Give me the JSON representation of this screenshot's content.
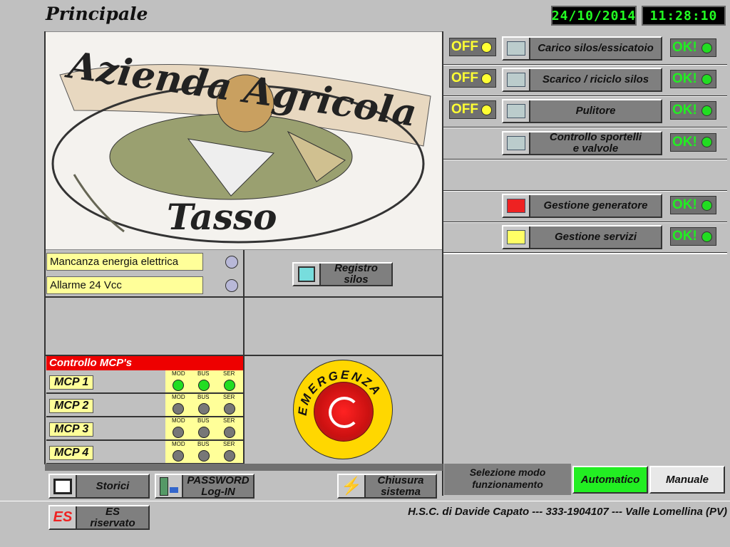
{
  "header": {
    "title": "Principale",
    "date": "24/10/2014",
    "time": "11:28:10"
  },
  "logo": {
    "line1": "Azienda Agricola",
    "line2": "Tasso"
  },
  "alarms": [
    {
      "label": "Mancanza energia elettrica"
    },
    {
      "label": "Allarme 24 Vcc"
    }
  ],
  "registro": {
    "label1": "Registro",
    "label2": "silos"
  },
  "mcp": {
    "header": "Controllo MCP's",
    "led_labels": [
      "MOD",
      "BUS",
      "SER"
    ],
    "rows": [
      {
        "label": "MCP 1",
        "leds": [
          "on",
          "on",
          "on"
        ]
      },
      {
        "label": "MCP 2",
        "leds": [
          "off",
          "off",
          "off"
        ]
      },
      {
        "label": "MCP 3",
        "leds": [
          "off",
          "off",
          "off"
        ]
      },
      {
        "label": "MCP 4",
        "leds": [
          "off",
          "off",
          "off"
        ]
      }
    ]
  },
  "emergency": {
    "label": "EMERGENZA"
  },
  "right_rows": [
    {
      "off": "OFF",
      "label": "Carico silos/essicatoio",
      "ok": "OK!",
      "icon": "silo-load-icon"
    },
    {
      "off": "OFF",
      "label": "Scarico / riciclo silos",
      "ok": "OK!",
      "icon": "silo-unload-icon"
    },
    {
      "off": "OFF",
      "label": "Pulitore",
      "ok": "OK!",
      "icon": "cleaner-icon"
    },
    {
      "off": null,
      "label": "Controllo sportelli\ne valvole",
      "ok": "OK!",
      "icon": "valve-panel-icon"
    },
    {
      "off": null,
      "label": null,
      "ok": null
    },
    {
      "off": null,
      "label": "Gestione generatore",
      "ok": "OK!",
      "icon": "generator-icon"
    },
    {
      "off": null,
      "label": "Gestione servizi",
      "ok": "OK!",
      "icon": "lightbulb-icon"
    }
  ],
  "bottom": {
    "storici": "Storici",
    "password1": "PASSWORD",
    "password2": "Log-IN",
    "chiusura1": "Chiusura",
    "chiusura2": "sistema",
    "es_icon": "ES",
    "es1": "ES",
    "es2": "riservato"
  },
  "mode": {
    "label1": "Selezione modo",
    "label2": "funzionamento",
    "auto": "Automatico",
    "manual": "Manuale"
  },
  "footer": {
    "credits": "H.S.C. di Davide Capato --- 333-1904107 --- Valle Lomellina (PV)"
  },
  "colors": {
    "ok_green": "#22dd22",
    "off_yellow": "#ffff33",
    "mcp_red": "#ee0000",
    "auto_green": "#22ee22"
  }
}
